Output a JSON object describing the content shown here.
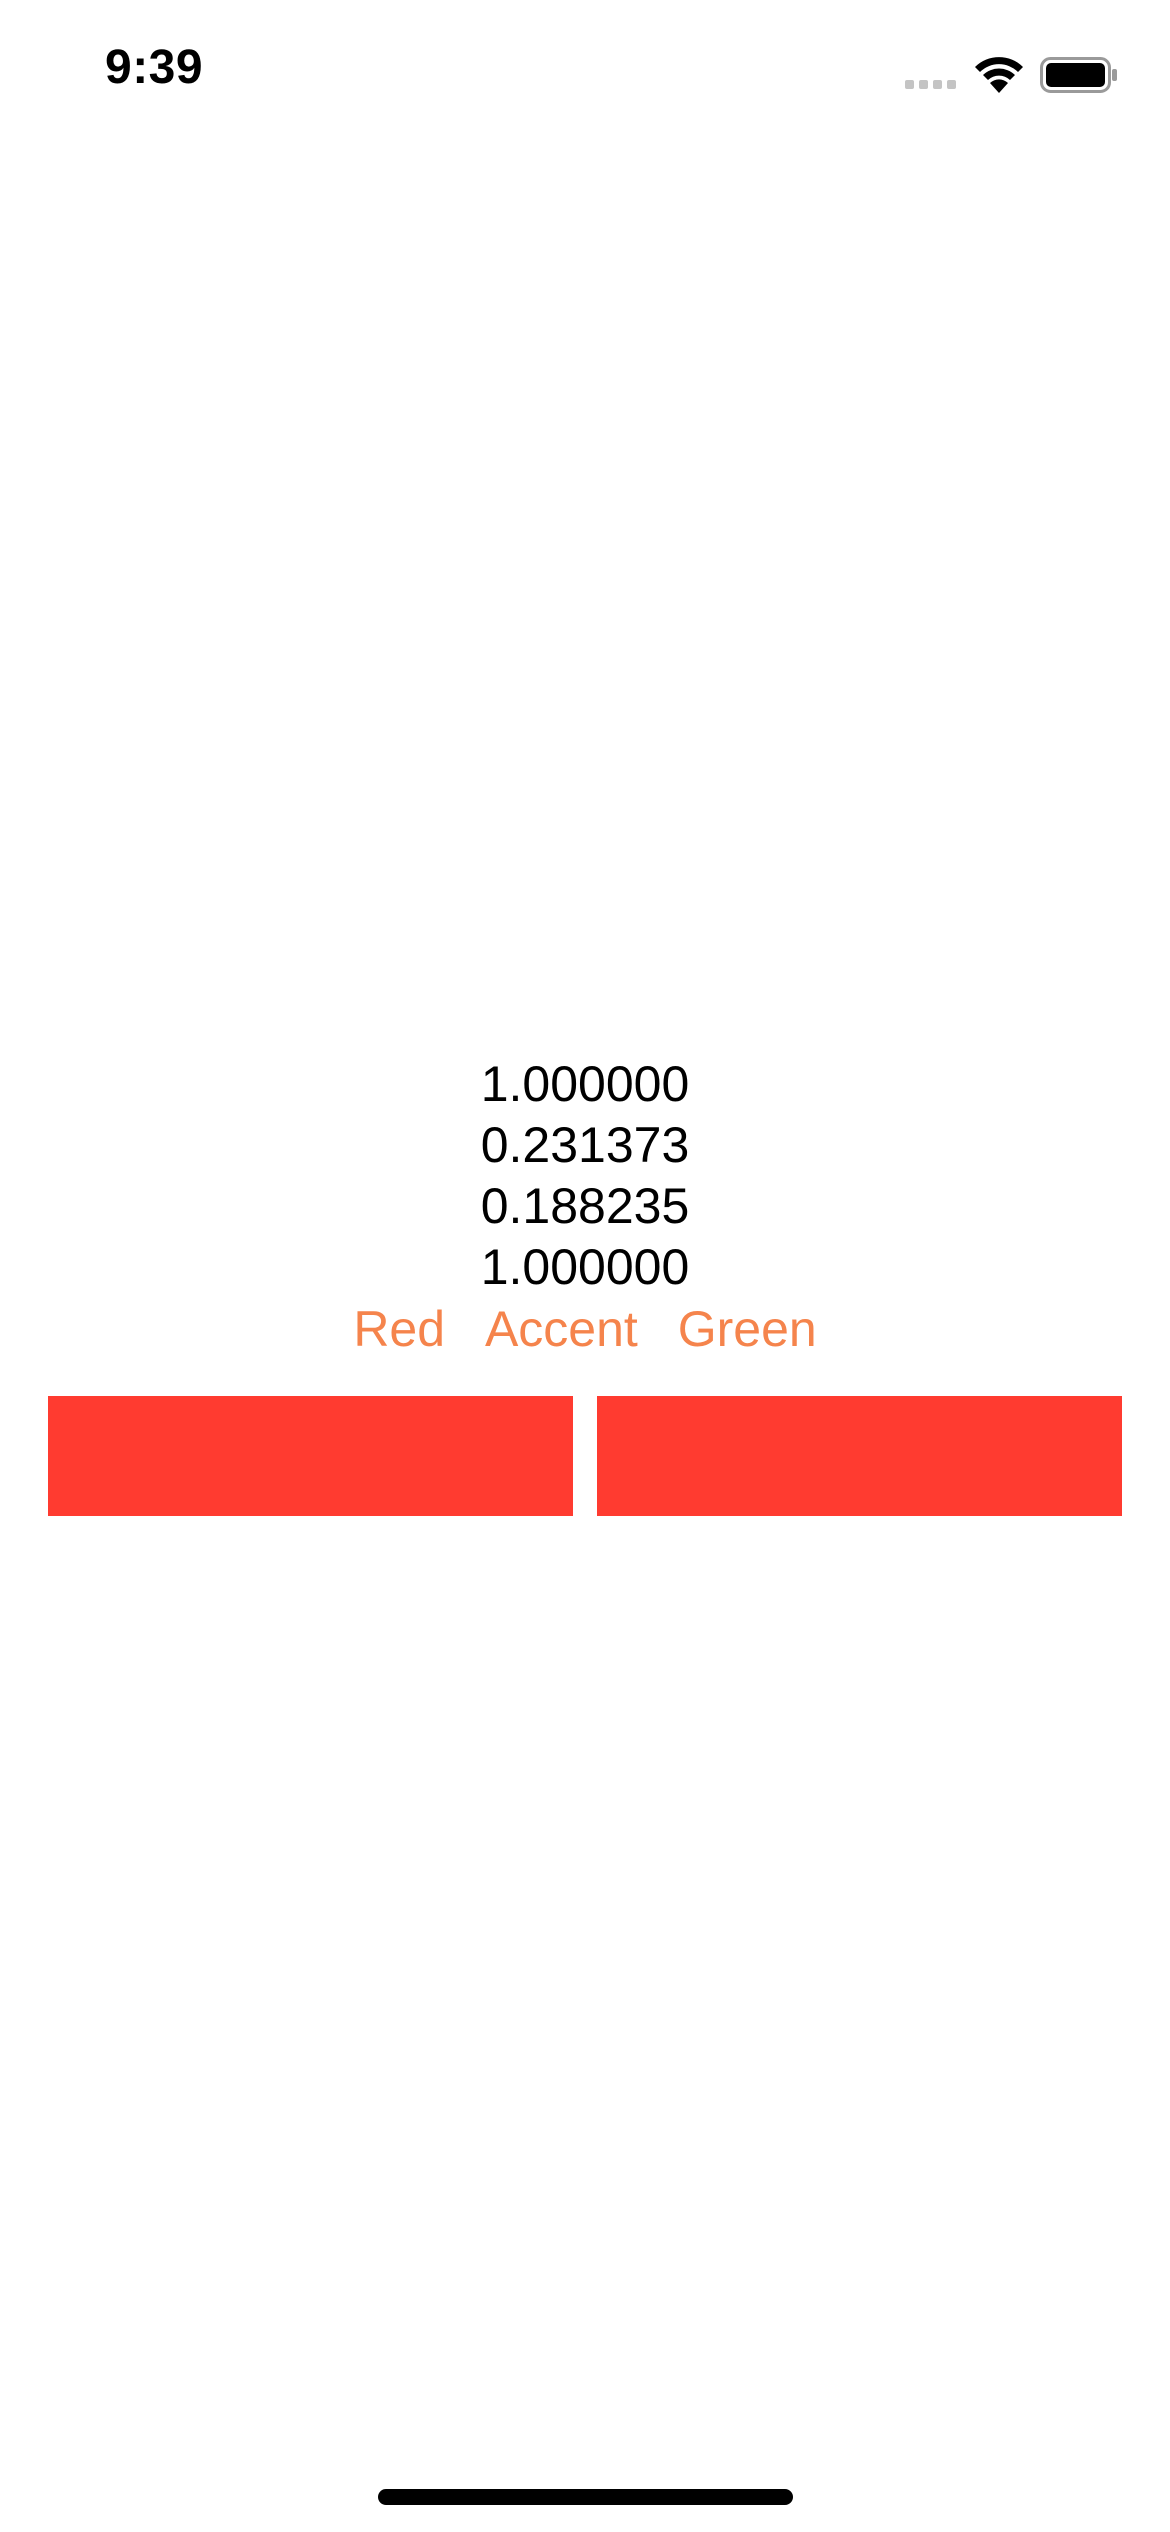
{
  "status_bar": {
    "time": "9:39",
    "wifi_icon": "wifi-icon",
    "battery_icon": "battery-icon",
    "signal_icon": "cellular-signal-icon"
  },
  "readouts": {
    "values": [
      "1.000000",
      "0.231373",
      "0.188235",
      "1.000000"
    ]
  },
  "color_names": {
    "items": [
      "Red",
      "Accent",
      "Green"
    ],
    "color": "#f5844c"
  },
  "swatches": {
    "left_color": "#ff3b30",
    "right_color": "#ff3b30"
  }
}
